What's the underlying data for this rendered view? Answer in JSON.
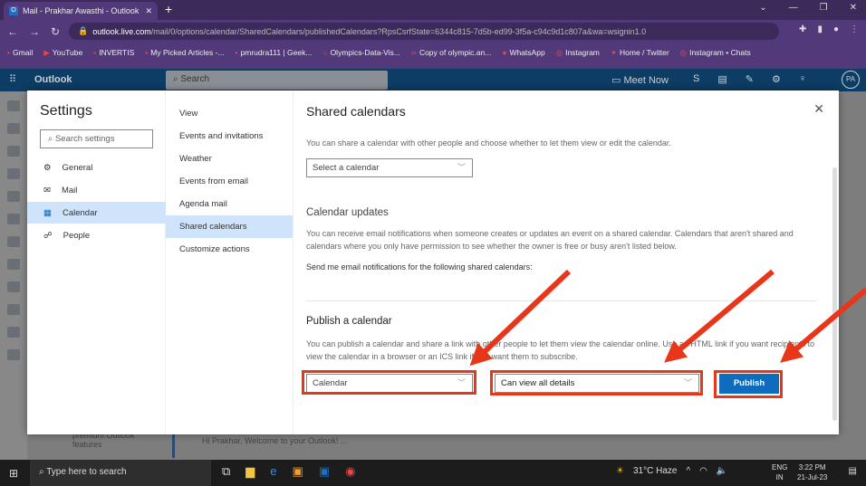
{
  "browser": {
    "tab_title": "Mail - Prakhar Awasthi - Outlook",
    "url_host": "outlook.live.com",
    "url_path": "/mail/0/options/calendar/SharedCalendars/publishedCalendars?RpsCsrfState=6344c815-7d5b-ed99-3f5a-c94c9d1c807a&wa=wsignin1.0",
    "bookmarks": [
      "Gmail",
      "YouTube",
      "INVERTIS",
      "My Picked Articles -...",
      "pmrudra111 | Geek...",
      "Olympics-Data-Vis...",
      "Copy of olympic.an...",
      "WhatsApp",
      "Instagram",
      "Home / Twitter",
      "Instagram • Chats"
    ]
  },
  "outlook": {
    "brand": "Outlook",
    "search_placeholder": "Search",
    "meet_now": "Meet Now",
    "avatar": "PA",
    "bg_premium": "premium Outlook features",
    "bg_mail_preview": "Hi Prakhar, Welcome to your Outlook! ..."
  },
  "settings": {
    "title": "Settings",
    "search_placeholder": "Search settings",
    "categories": [
      {
        "label": "General",
        "icon": "⚙"
      },
      {
        "label": "Mail",
        "icon": "✉"
      },
      {
        "label": "Calendar",
        "icon": "▦"
      },
      {
        "label": "People",
        "icon": "☍"
      }
    ],
    "subitems": [
      "View",
      "Events and invitations",
      "Weather",
      "Events from email",
      "Agenda mail",
      "Shared calendars",
      "Customize actions"
    ]
  },
  "panel": {
    "title": "Shared calendars",
    "share_text": "You can share a calendar with other people and choose whether to let them view or edit the calendar.",
    "share_select": "Select a calendar",
    "updates_heading": "Calendar updates",
    "updates_text": "You can receive email notifications when someone creates or updates an event on a shared calendar. Calendars that aren't shared and calendars where you only have permission to see whether the owner is free or busy aren't listed below.",
    "notify_text": "Send me email notifications for the following shared calendars:",
    "publish_heading": "Publish a calendar",
    "publish_text": "You can publish a calendar and share a link with other people to let them view the calendar online. Use an HTML link if you want recipients to view the calendar in a browser or an ICS link if you want them to subscribe.",
    "calendar_select": "Calendar",
    "permission_select": "Can view all details",
    "publish_button": "Publish"
  },
  "annotation_color": "#e8361b",
  "taskbar": {
    "search_placeholder": "Type here to search",
    "weather": "31°C  Haze",
    "lang1": "ENG",
    "lang2": "IN",
    "time": "3:22 PM",
    "date": "21-Jul-23"
  }
}
